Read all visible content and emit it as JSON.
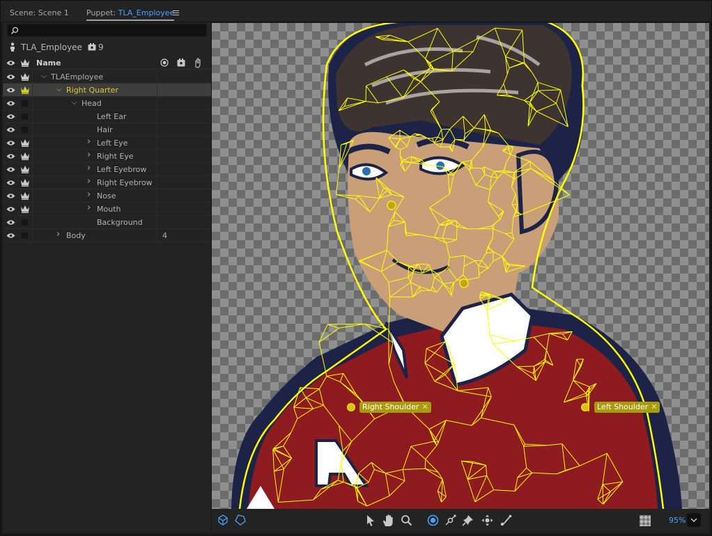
{
  "tabs": {
    "scene_label": "Scene: Scene 1",
    "puppet_prefix": "Puppet: ",
    "puppet_name": "TLA_Employee"
  },
  "puppet_panel": {
    "search_placeholder": "",
    "puppet_name": "TLA_Employee",
    "handle_count": "9",
    "header_name": "Name"
  },
  "layers": [
    {
      "name": "TLAEmployee",
      "indent": 0,
      "chevron": "open",
      "crown": true,
      "count": ""
    },
    {
      "name": "Right Quarter",
      "indent": 1,
      "chevron": "open",
      "crown": true,
      "count": "",
      "selected": true
    },
    {
      "name": "Head",
      "indent": 2,
      "chevron": "open",
      "crown": false,
      "count": ""
    },
    {
      "name": "Left Ear",
      "indent": 3,
      "chevron": "none",
      "crown": false,
      "count": ""
    },
    {
      "name": "Hair",
      "indent": 3,
      "chevron": "none",
      "crown": false,
      "count": ""
    },
    {
      "name": "Left Eye",
      "indent": 3,
      "chevron": "closed",
      "crown": true,
      "count": ""
    },
    {
      "name": "Right Eye",
      "indent": 3,
      "chevron": "closed",
      "crown": true,
      "count": ""
    },
    {
      "name": "Left Eyebrow",
      "indent": 3,
      "chevron": "closed",
      "crown": true,
      "count": ""
    },
    {
      "name": "Right Eyebrow",
      "indent": 3,
      "chevron": "closed",
      "crown": true,
      "count": ""
    },
    {
      "name": "Nose",
      "indent": 3,
      "chevron": "closed",
      "crown": true,
      "count": ""
    },
    {
      "name": "Mouth",
      "indent": 3,
      "chevron": "closed",
      "crown": true,
      "count": ""
    },
    {
      "name": "Background",
      "indent": 3,
      "chevron": "none",
      "crown": false,
      "count": ""
    },
    {
      "name": "Body",
      "indent": 1,
      "chevron": "closed",
      "crown": false,
      "count": "4"
    }
  ],
  "canvas": {
    "handles": [
      {
        "label": "Right Shoulder"
      },
      {
        "label": "Left Shoulder"
      }
    ],
    "mesh_color": "#ffff00"
  },
  "toolbar": {
    "zoom": "95%"
  },
  "colors": {
    "accent": "#4aa3ff",
    "selected_layer": "#d6cc2a",
    "handle_tag": "#a89c0c"
  }
}
